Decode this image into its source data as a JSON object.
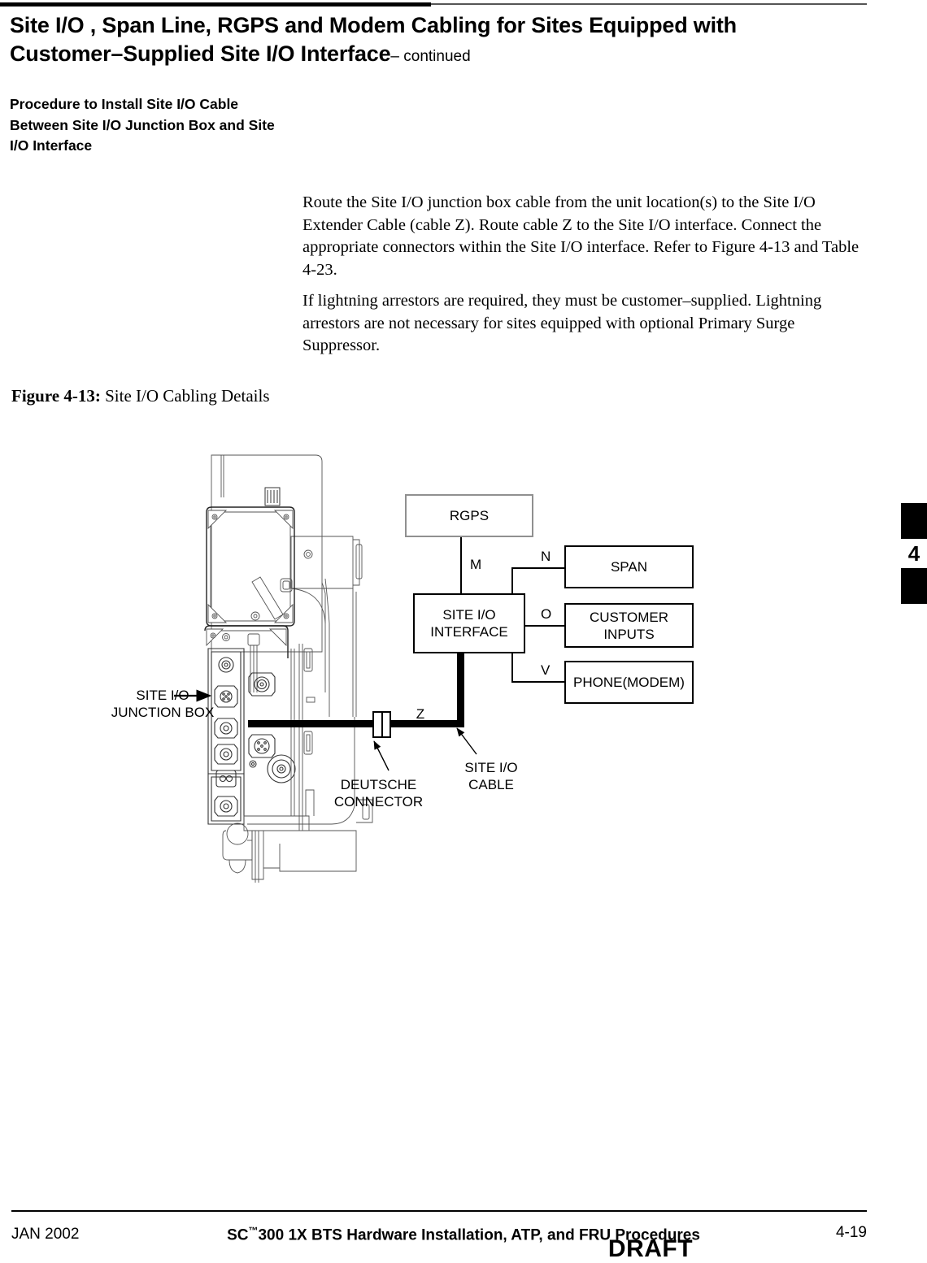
{
  "header": {
    "title_line1": "Site I/O , Span Line, RGPS and Modem Cabling for Sites Equipped with",
    "title_line2": "Customer–Supplied Site I/O Interface",
    "continued": "– continued"
  },
  "section": {
    "heading": "Procedure to Install Site I/O Cable Between Site I/O Junction Box and Site I/O Interface"
  },
  "body": {
    "paragraph_1": "Route the Site I/O junction box cable from the unit location(s) to the Site I/O Extender Cable (cable Z).  Route cable Z to the Site I/O interface.  Connect the appropriate connectors within the Site I/O interface.  Refer to Figure 4-13 and Table 4-23.",
    "paragraph_2": "If lightning arrestors are required, they must be customer–supplied. Lightning arrestors are not necessary for sites equipped with optional Primary Surge Suppressor."
  },
  "figure": {
    "caption_label": "Figure 4-13:",
    "caption_text": "Site I/O Cabling Details",
    "blocks": {
      "rgps": "RGPS",
      "site_io_interface": "SITE I/O\nINTERFACE",
      "site_io_interface_line1": "SITE I/O",
      "site_io_interface_line2": "INTERFACE",
      "span": "SPAN",
      "customer_inputs_line1": "CUSTOMER",
      "customer_inputs_line2": "INPUTS",
      "phone_modem": "PHONE(MODEM)"
    },
    "wire_labels": {
      "m": "M",
      "n": "N",
      "o": "O",
      "v": "V",
      "z": "Z"
    },
    "callouts": {
      "junction_box_line1": "SITE I/O",
      "junction_box_line2": "JUNCTION BOX",
      "deutsche_line1": "DEUTSCHE",
      "deutsche_line2": "CONNECTOR",
      "cable_line1": "SITE I/O",
      "cable_line2": "CABLE"
    }
  },
  "chapter_tab": {
    "number": "4"
  },
  "footer": {
    "date": "JAN 2002",
    "doc_title_prefix": "SC",
    "doc_title_tm": "™",
    "doc_title_rest": "300 1X BTS Hardware Installation, ATP, and FRU Procedures",
    "page_number": "4-19",
    "draft": "DRAFT"
  },
  "colors": {
    "rule_black": "#000000",
    "rule_gray": "#555555",
    "box_border": "#000000",
    "rgps_box_border": "#909090"
  }
}
